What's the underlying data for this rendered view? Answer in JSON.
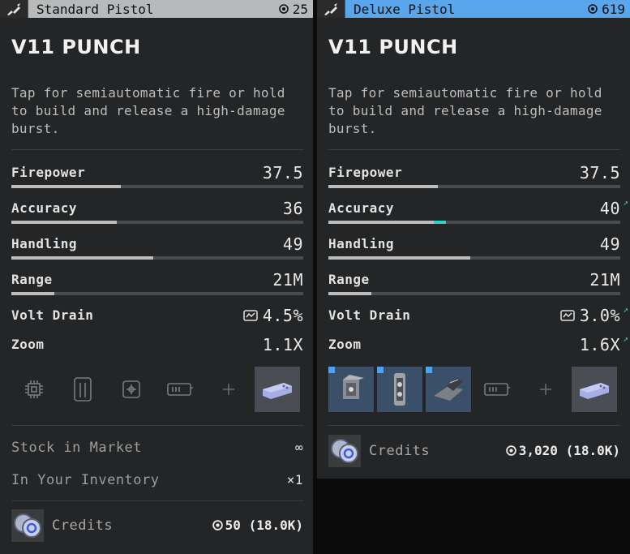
{
  "standard": {
    "header": {
      "name": "Standard Pistol",
      "cost": "25"
    },
    "weapon_name": "V11 PUNCH",
    "description": "Tap for semiautomatic fire or hold to build and release a high-damage burst.",
    "stats": {
      "firepower": {
        "label": "Firepower",
        "value": "37.5",
        "fill": 0.375
      },
      "accuracy": {
        "label": "Accuracy",
        "value": "36",
        "fill": 0.36
      },
      "handling": {
        "label": "Handling",
        "value": "49",
        "fill": 0.49
      },
      "range": {
        "label": "Range",
        "value": "21M",
        "fill": 0.15
      },
      "volt_drain": {
        "label": "Volt Drain",
        "value": "4.5%"
      },
      "zoom": {
        "label": "Zoom",
        "value": "1.1X"
      }
    },
    "stock": {
      "label": "Stock in Market",
      "value": "∞"
    },
    "inventory": {
      "label": "In Your Inventory",
      "value": "×1"
    },
    "credits": {
      "label": "Credits",
      "value": "50 (18.0K)"
    }
  },
  "deluxe": {
    "header": {
      "name": "Deluxe Pistol",
      "cost": "619"
    },
    "weapon_name": "V11 PUNCH",
    "description": "Tap for semiautomatic fire or hold to build and release a high-damage burst.",
    "stats": {
      "firepower": {
        "label": "Firepower",
        "value": "37.5",
        "fill": 0.375
      },
      "accuracy": {
        "label": "Accuracy",
        "value": "40",
        "fill": 0.36,
        "bonus": 0.04
      },
      "handling": {
        "label": "Handling",
        "value": "49",
        "fill": 0.49
      },
      "range": {
        "label": "Range",
        "value": "21M",
        "fill": 0.15
      },
      "volt_drain": {
        "label": "Volt Drain",
        "value": "3.0%"
      },
      "zoom": {
        "label": "Zoom",
        "value": "1.6X"
      }
    },
    "credits": {
      "label": "Credits",
      "value": "3,020 (18.0K)"
    }
  },
  "icons": {
    "header_weapon": "pistol-icon",
    "currency": "credit-chip-icon",
    "volt": "battery-icon",
    "improved": "arrow-up-right-icon",
    "slots": [
      "chip-slot-icon",
      "barrel-slot-icon",
      "optic-slot-icon",
      "magazine-slot-icon",
      "plus-icon",
      "shell-slot-icon"
    ]
  },
  "colors": {
    "standard_header": "#b7b9bb",
    "deluxe_header": "#5aa6ec",
    "stat_bonus": "#2ad3c4"
  }
}
